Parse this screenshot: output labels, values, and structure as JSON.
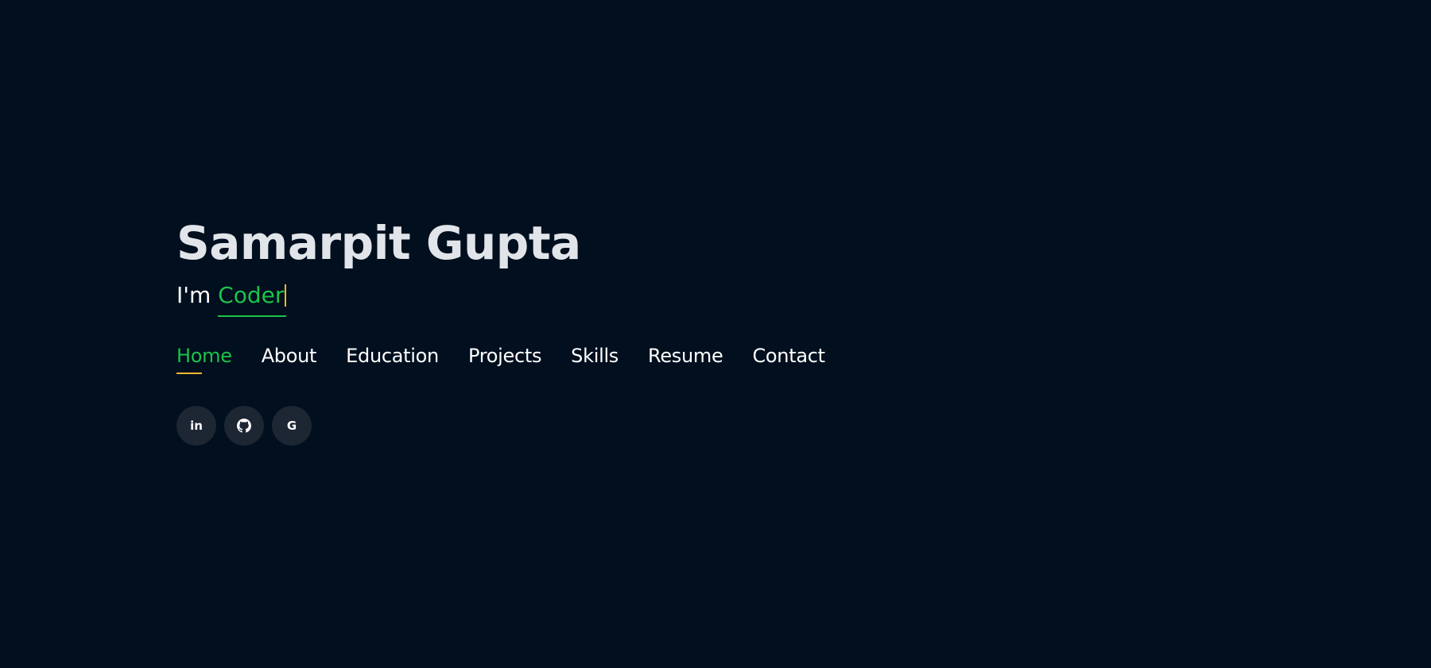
{
  "hero": {
    "name": "Samarpit Gupta",
    "tagline_prefix": "I'm ",
    "tagline_typed": "Coder"
  },
  "nav": {
    "items": [
      {
        "label": "Home",
        "active": true
      },
      {
        "label": "About"
      },
      {
        "label": "Education"
      },
      {
        "label": "Projects"
      },
      {
        "label": "Skills"
      },
      {
        "label": "Resume"
      },
      {
        "label": "Contact"
      }
    ]
  },
  "social": {
    "items": [
      {
        "icon": "linkedin-icon",
        "glyph": "in"
      },
      {
        "icon": "github-icon",
        "glyph": ""
      },
      {
        "icon": "google-icon",
        "glyph": "G"
      }
    ]
  },
  "colors": {
    "background": "#010f1e",
    "accent": "#1bc34a",
    "cursor": "#f5b82e",
    "social_bg": "#1d2633"
  }
}
